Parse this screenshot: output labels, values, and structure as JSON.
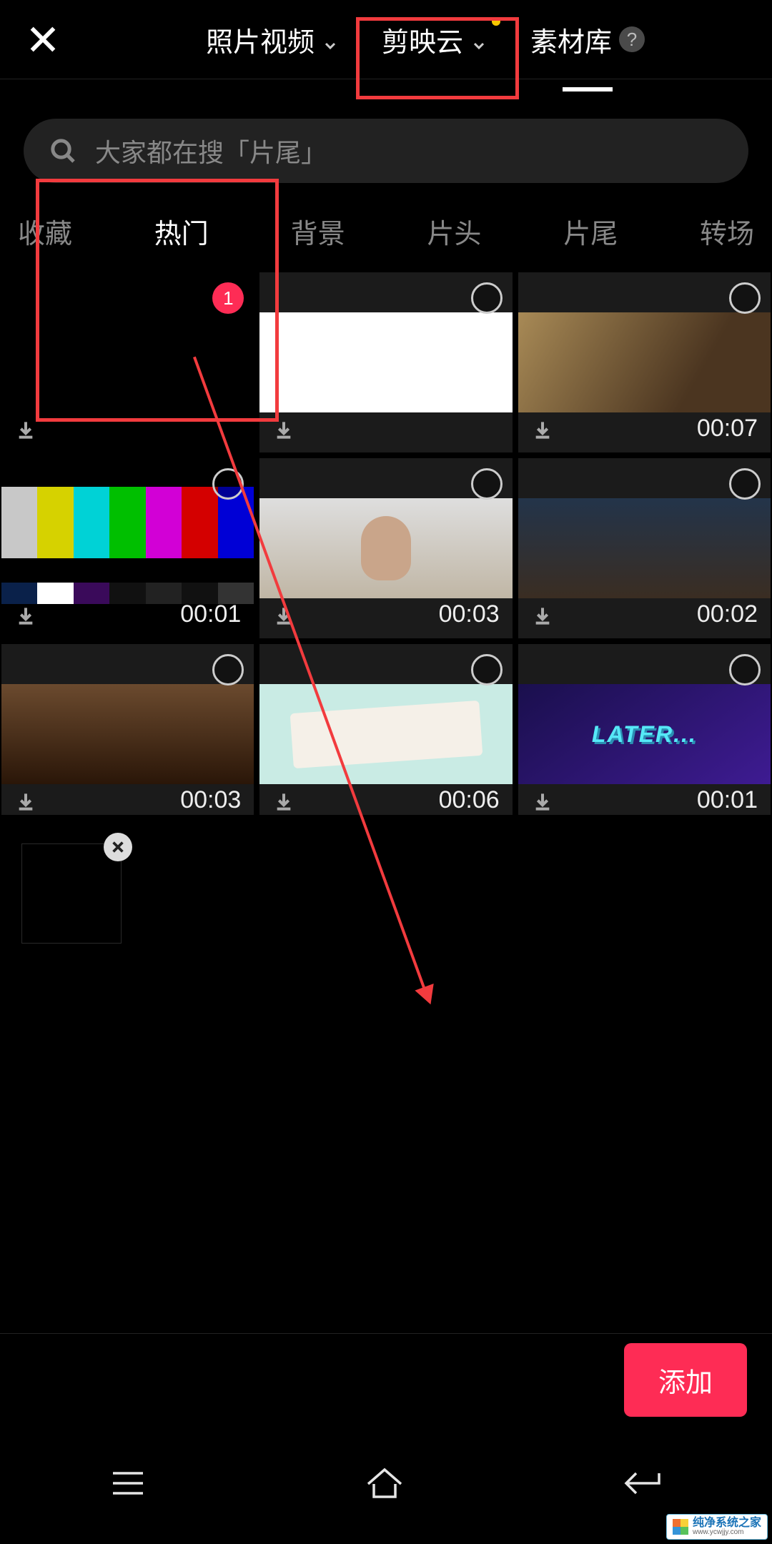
{
  "header": {
    "tabs": [
      {
        "label": "照片视频",
        "chevron": true
      },
      {
        "label": "剪映云",
        "chevron": true,
        "dot": true
      },
      {
        "label": "素材库",
        "help": true,
        "active": true
      }
    ]
  },
  "search": {
    "placeholder": "大家都在搜「片尾」"
  },
  "category_tabs": [
    "收藏",
    "热门",
    "背景",
    "片头",
    "片尾",
    "转场"
  ],
  "category_active_index": 1,
  "clips": [
    {
      "id": "black",
      "duration": "",
      "selected_order": "1"
    },
    {
      "id": "white",
      "duration": ""
    },
    {
      "id": "room",
      "duration": "00:07"
    },
    {
      "id": "bars",
      "duration": "00:01"
    },
    {
      "id": "nice",
      "duration": "00:03"
    },
    {
      "id": "godfather",
      "duration": "00:02"
    },
    {
      "id": "jjj",
      "duration": "00:03"
    },
    {
      "id": "paper",
      "duration": "00:06"
    },
    {
      "id": "later",
      "duration": "00:01",
      "overlay_text": "LATER..."
    }
  ],
  "bottom": {
    "add_label": "添加"
  },
  "watermark": {
    "line1": "纯净系统之家",
    "line2": "www.ycwjjy.com"
  }
}
